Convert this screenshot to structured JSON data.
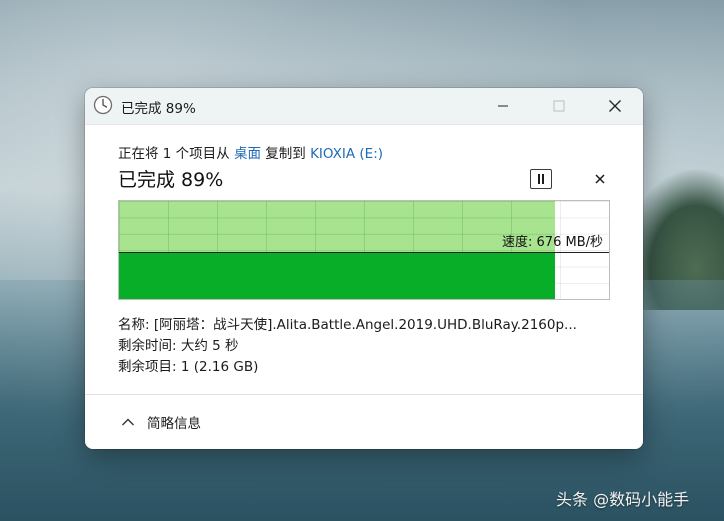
{
  "window": {
    "title": "已完成 89%",
    "controls": {
      "minimize": "minimize",
      "maximize": "maximize",
      "close": "close"
    }
  },
  "transfer": {
    "desc_prefix": "正在将 1 个项目从",
    "source": "桌面",
    "desc_mid": "复制到",
    "destination": "KIOXIA (E:)",
    "headline": "已完成 89%",
    "progress_percent": 89,
    "current_speed_fraction_of_graph": 0.48,
    "speed_label": "速度: 676 MB/秒"
  },
  "details": {
    "name_label": "名称:",
    "name_value": "[阿丽塔：战斗天使].Alita.Battle.Angel.2019.UHD.BluRay.2160p...",
    "time_label": "剩余时间:",
    "time_value": "大约 5 秒",
    "items_label": "剩余项目:",
    "items_value": "1 (2.16 GB)"
  },
  "footer": {
    "toggle_label": "简略信息"
  },
  "watermark": "头条 @数码小能手",
  "colors": {
    "progress_fill": "#a8e490",
    "speed_fill": "#08ad28",
    "link": "#1f6ab5"
  },
  "icons": {
    "title": "clock-icon",
    "pause": "pause-icon",
    "cancel": "close-icon",
    "collapse": "chevron-up-icon"
  }
}
